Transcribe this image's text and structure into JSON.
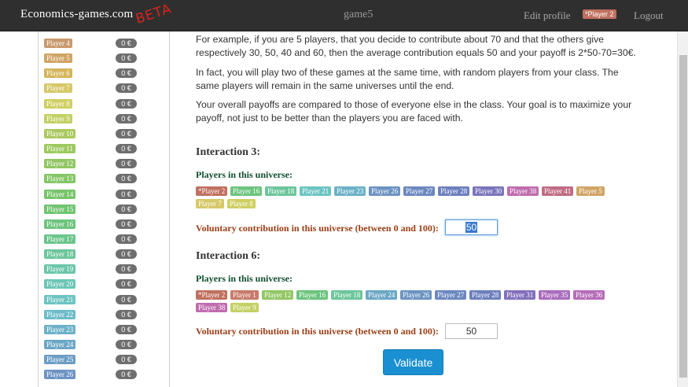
{
  "navbar": {
    "brand": "Economics-games.com",
    "beta": "BETA",
    "game": "game5",
    "edit_profile": "Edit profile",
    "user_badge": "*Player 2",
    "logout": "Logout"
  },
  "sidebar": {
    "players": [
      {
        "name": "Player 4",
        "value": "0 €",
        "color": "#c99a6e"
      },
      {
        "name": "Player 5",
        "value": "0 €",
        "color": "#d1a465"
      },
      {
        "name": "Player 6",
        "value": "0 €",
        "color": "#d4b55a"
      },
      {
        "name": "Player 7",
        "value": "0 €",
        "color": "#d6c867"
      },
      {
        "name": "Player 8",
        "value": "0 €",
        "color": "#cfcf63"
      },
      {
        "name": "Player 9",
        "value": "0 €",
        "color": "#c3d064"
      },
      {
        "name": "Player 10",
        "value": "0 €",
        "color": "#acc960"
      },
      {
        "name": "Player 11",
        "value": "0 €",
        "color": "#9ec95f"
      },
      {
        "name": "Player 12",
        "value": "0 €",
        "color": "#92c764"
      },
      {
        "name": "Player 13",
        "value": "0 €",
        "color": "#84c666"
      },
      {
        "name": "Player 14",
        "value": "0 €",
        "color": "#77c46a"
      },
      {
        "name": "Player 15",
        "value": "0 €",
        "color": "#6fc470"
      },
      {
        "name": "Player 16",
        "value": "0 €",
        "color": "#6cc47d"
      },
      {
        "name": "Player 17",
        "value": "0 €",
        "color": "#6cc58c"
      },
      {
        "name": "Player 18",
        "value": "0 €",
        "color": "#6cc69b"
      },
      {
        "name": "Player 19",
        "value": "0 €",
        "color": "#6cc6a9"
      },
      {
        "name": "Player 20",
        "value": "0 €",
        "color": "#6cc6b6"
      },
      {
        "name": "Player 21",
        "value": "0 €",
        "color": "#6cc4c2"
      },
      {
        "name": "Player 22",
        "value": "0 €",
        "color": "#6cbcc8"
      },
      {
        "name": "Player 23",
        "value": "0 €",
        "color": "#6cb1c8"
      },
      {
        "name": "Player 24",
        "value": "0 €",
        "color": "#6ca7c6"
      },
      {
        "name": "Player 25",
        "value": "0 €",
        "color": "#6c9dc4"
      },
      {
        "name": "Player 26",
        "value": "0 €",
        "color": "#6c93c2"
      }
    ]
  },
  "content": {
    "paragraph1": "For example, if you are 5 players, that you decide to contribute about 70 and that the others give respectively 30, 50, 40 and 60, then the average contribution equals 50 and your payoff is 2*50-70=30€.",
    "paragraph2": "In fact, you will play two of these games at the same time, with random players from your class. The same players will remain in the same universes until the end.",
    "paragraph3": "Your overall payoffs are compared to those of everyone else in the class. Your goal is to maximize your payoff, not just to be better than the players you are faced with.",
    "interaction3": {
      "title": "Interaction 3:",
      "players_heading": "Players in this universe:",
      "players": [
        {
          "name": "*Player 2",
          "color": "#c0705f"
        },
        {
          "name": "Player 16",
          "color": "#6cc47d"
        },
        {
          "name": "Player 18",
          "color": "#6cc69b"
        },
        {
          "name": "Player 21",
          "color": "#6cc4c2"
        },
        {
          "name": "Player 23",
          "color": "#6cb1c8"
        },
        {
          "name": "Player 26",
          "color": "#6c93c2"
        },
        {
          "name": "Player 27",
          "color": "#6c88c0"
        },
        {
          "name": "Player 28",
          "color": "#6c7fbe"
        },
        {
          "name": "Player 30",
          "color": "#7a74bc"
        },
        {
          "name": "Player 38",
          "color": "#c06cae"
        },
        {
          "name": "Player 41",
          "color": "#c06c84"
        },
        {
          "name": "Player 5",
          "color": "#d1a465"
        },
        {
          "name": "Player 7",
          "color": "#d6c867"
        },
        {
          "name": "Player 8",
          "color": "#cfcf63"
        }
      ],
      "contribution_label": "Voluntary contribution in this universe (between 0 and 100):",
      "contribution_value": "50"
    },
    "interaction6": {
      "title": "Interaction 6:",
      "players_heading": "Players in this universe:",
      "players": [
        {
          "name": "*Player 2",
          "color": "#c0705f"
        },
        {
          "name": "Player 1",
          "color": "#c97a6a"
        },
        {
          "name": "Player 12",
          "color": "#92c764"
        },
        {
          "name": "Player 16",
          "color": "#6cc47d"
        },
        {
          "name": "Player 18",
          "color": "#6cc69b"
        },
        {
          "name": "Player 24",
          "color": "#6ca7c6"
        },
        {
          "name": "Player 26",
          "color": "#6c93c2"
        },
        {
          "name": "Player 27",
          "color": "#6c88c0"
        },
        {
          "name": "Player 28",
          "color": "#6c7fbe"
        },
        {
          "name": "Player 31",
          "color": "#8270bc"
        },
        {
          "name": "Player 35",
          "color": "#aa6cbc"
        },
        {
          "name": "Player 36",
          "color": "#b66cb8"
        },
        {
          "name": "Player 38",
          "color": "#c06cae"
        },
        {
          "name": "Player 9",
          "color": "#c3d064"
        }
      ],
      "contribution_label": "Voluntary contribution in this universe (between 0 and 100):",
      "contribution_value": "50"
    },
    "validate_label": "Validate"
  }
}
